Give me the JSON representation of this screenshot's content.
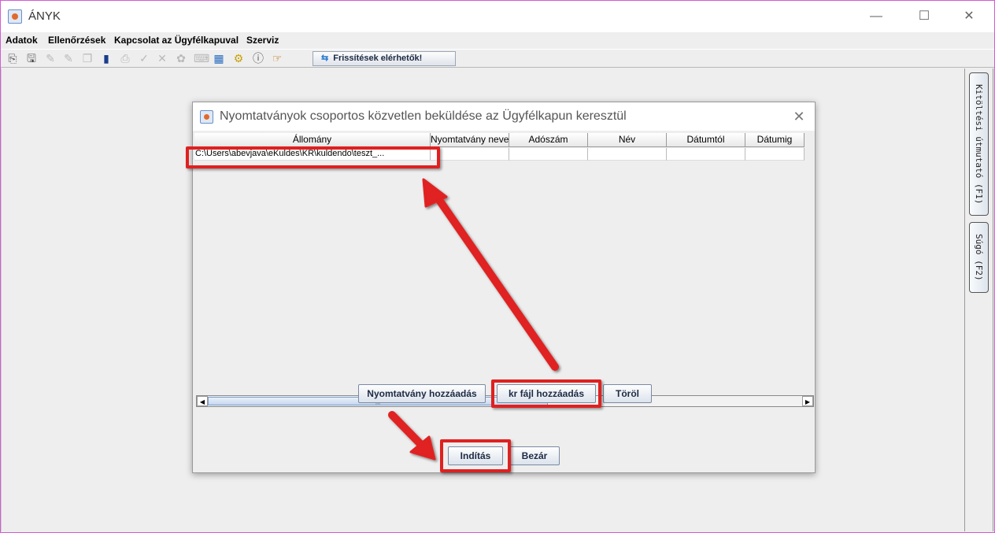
{
  "window": {
    "title": "ÁNYK",
    "minimize": "—",
    "maximize": "☐",
    "close": "✕"
  },
  "menu": {
    "items": [
      "Adatok",
      "Ellenőrzések",
      "Kapcsolat az Ügyfélkapuval",
      "Szerviz"
    ]
  },
  "toolbar": {
    "updates_label": "Frissítések elérhetők!",
    "icons": [
      "new-document-icon",
      "save-icon",
      "edit-icon",
      "edit-disabled-icon",
      "copy-icon",
      "form-icon",
      "print-icon",
      "check-icon",
      "delete-icon",
      "attach-icon",
      "keyboard-icon",
      "calculator-icon",
      "tools-icon",
      "info-icon",
      "exit-icon"
    ]
  },
  "side_tabs": {
    "guide": "Kitöltési útmutató (F1)",
    "help": "Súgó (F2)"
  },
  "dialog": {
    "title": "Nyomtatványok csoportos közvetlen beküldése az Ügyfélkapun keresztül",
    "close": "✕",
    "table": {
      "columns": [
        "Állomány",
        "Nyomtatvány neve",
        "Adószám",
        "Név",
        "Dátumtól",
        "Dátumig"
      ],
      "rows": [
        [
          "C:\\Users\\abevjava\\eKuldes\\KR\\kuldendo\\teszt_...",
          "",
          "",
          "",
          "",
          ""
        ]
      ]
    },
    "scrollbar": {
      "left": "◀",
      "right": "▶",
      "grip": "|||"
    },
    "buttons": {
      "add_form": "Nyomtatvány hozzáadás",
      "add_kr": "kr fájl hozzáadás",
      "delete": "Töröl",
      "start": "Indítás",
      "close": "Bezár"
    }
  },
  "colors": {
    "highlight": "#e02020",
    "frame": "#d35bd3"
  }
}
